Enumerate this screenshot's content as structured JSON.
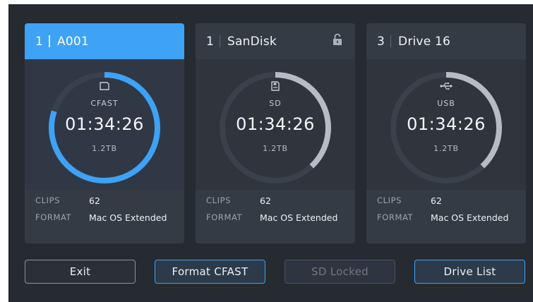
{
  "cards": [
    {
      "slot": "1",
      "name": "A001",
      "active": true,
      "locked": false,
      "media_icon": "cfast-card-icon",
      "media_type": "CFAST",
      "timecode": "01:34:26",
      "capacity": "1.2TB",
      "fill_fraction": 0.8,
      "clips_label": "CLIPS",
      "clips": "62",
      "format_label": "FORMAT",
      "format": "Mac OS Extended"
    },
    {
      "slot": "1",
      "name": "SanDisk",
      "active": false,
      "locked": true,
      "media_icon": "sd-card-icon",
      "media_type": "SD",
      "timecode": "01:34:26",
      "capacity": "1.2TB",
      "fill_fraction": 0.38,
      "clips_label": "CLIPS",
      "clips": "62",
      "format_label": "FORMAT",
      "format": "Mac OS Extended"
    },
    {
      "slot": "3",
      "name": "Drive 16",
      "active": false,
      "locked": false,
      "media_icon": "usb-icon",
      "media_type": "USB",
      "timecode": "01:34:26",
      "capacity": "1.2TB",
      "fill_fraction": 0.38,
      "clips_label": "CLIPS",
      "clips": "62",
      "format_label": "FORMAT",
      "format": "Mac OS Extended"
    }
  ],
  "buttons": {
    "exit": "Exit",
    "format": "Format CFAST",
    "sd_locked": "SD Locked",
    "drive_list": "Drive List"
  },
  "colors": {
    "accent": "#3ea2f5",
    "gauge_track": "#3a414c",
    "gauge_fill_inactive": "#b5bcc6",
    "background": "#262a31"
  }
}
